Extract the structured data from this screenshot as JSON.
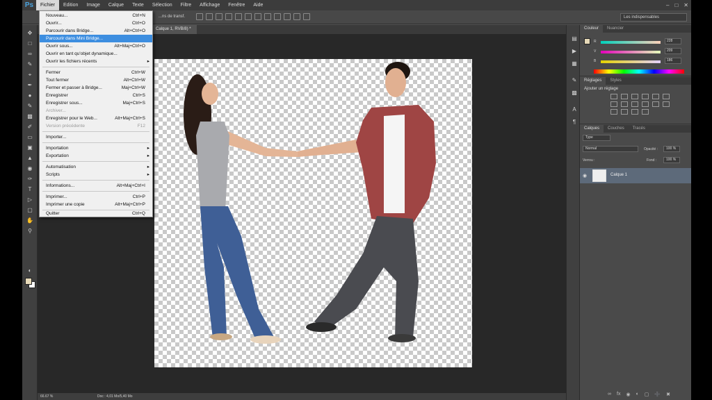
{
  "menubar": {
    "logo": "Ps",
    "items": [
      "Fichier",
      "Edition",
      "Image",
      "Calque",
      "Texte",
      "Sélection",
      "Filtre",
      "Affichage",
      "Fenêtre",
      "Aide"
    ],
    "active": "Fichier"
  },
  "options_bar": {
    "label": "...ns de transf.",
    "workspace": "Les indispensables"
  },
  "document_tab": "Calque 1, RVB/8) *",
  "file_menu": {
    "nouveau": {
      "label": "Nouveau...",
      "shortcut": "Ctrl+N"
    },
    "ouvrir": {
      "label": "Ouvrir...",
      "shortcut": "Ctrl+O"
    },
    "parcourir_bridge": {
      "label": "Parcourir dans Bridge...",
      "shortcut": "Alt+Ctrl+O"
    },
    "parcourir_mini": {
      "label": "Parcourir dans Mini Bridge...",
      "shortcut": ""
    },
    "ouvrir_sous": {
      "label": "Ouvrir sous...",
      "shortcut": "Alt+Maj+Ctrl+O"
    },
    "ouvrir_dynamique": {
      "label": "Ouvrir en tant qu'objet dynamique...",
      "shortcut": ""
    },
    "recents": {
      "label": "Ouvrir les fichiers récents",
      "shortcut": ""
    },
    "fermer": {
      "label": "Fermer",
      "shortcut": "Ctrl+W"
    },
    "tout_fermer": {
      "label": "Tout fermer",
      "shortcut": "Alt+Ctrl+W"
    },
    "fermer_bridge": {
      "label": "Fermer et passer à Bridge...",
      "shortcut": "Maj+Ctrl+W"
    },
    "enregistrer": {
      "label": "Enregistrer",
      "shortcut": "Ctrl+S"
    },
    "enregistrer_sous": {
      "label": "Enregistrer sous...",
      "shortcut": "Maj+Ctrl+S"
    },
    "archiver": {
      "label": "Archiver...",
      "shortcut": ""
    },
    "enregistrer_web": {
      "label": "Enregistrer pour le Web...",
      "shortcut": "Alt+Maj+Ctrl+S"
    },
    "version_precedente": {
      "label": "Version précédente",
      "shortcut": "F12"
    },
    "importer": {
      "label": "Importer...",
      "shortcut": ""
    },
    "importation": {
      "label": "Importation",
      "shortcut": ""
    },
    "exportation": {
      "label": "Exportation",
      "shortcut": ""
    },
    "automatisation": {
      "label": "Automatisation",
      "shortcut": ""
    },
    "scripts": {
      "label": "Scripts",
      "shortcut": ""
    },
    "informations": {
      "label": "Informations...",
      "shortcut": "Alt+Maj+Ctrl+I"
    },
    "imprimer": {
      "label": "Imprimer...",
      "shortcut": "Ctrl+P"
    },
    "imprimer_copie": {
      "label": "Imprimer une copie",
      "shortcut": "Alt+Maj+Ctrl+P"
    },
    "quitter": {
      "label": "Quitter",
      "shortcut": "Ctrl+Q"
    }
  },
  "color_panel": {
    "tabs": [
      "Couleur",
      "Nuancier"
    ],
    "r": {
      "label": "R",
      "value": "228"
    },
    "v": {
      "label": "V",
      "value": "209"
    },
    "b": {
      "label": "B",
      "value": "186"
    },
    "foreground": "#e6d9b8"
  },
  "adjust_panel": {
    "tabs": [
      "Réglages",
      "Styles"
    ],
    "title": "Ajouter un réglage"
  },
  "layers_panel": {
    "tabs": [
      "Calques",
      "Couches",
      "Tracés"
    ],
    "filter": "Type",
    "blend_mode": "Normal",
    "opacity_label": "Opacité :",
    "opacity": "100 %",
    "lock_label": "Verrou :",
    "fill_label": "Fond :",
    "fill": "100 %",
    "layer_name": "Calque 1"
  },
  "status": {
    "zoom": "66.67 %",
    "doc": "Doc : 4,01 Mo/5,40 Mo"
  }
}
